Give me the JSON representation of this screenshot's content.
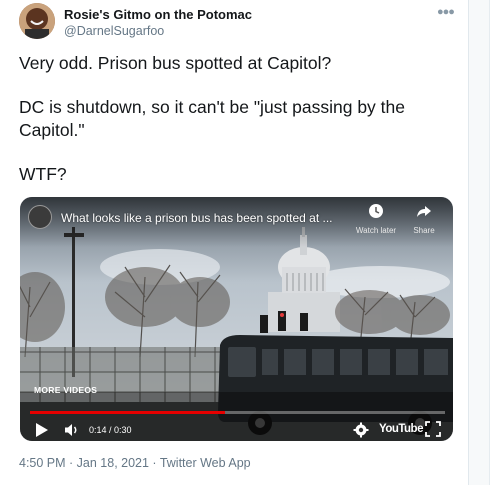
{
  "tweet": {
    "display_name": "Rosie's Gitmo on the Potomac",
    "handle": "@DarnelSugarfoo",
    "more_icon": "ellipsis-icon",
    "paragraphs": [
      "Very odd. Prison bus spotted at Capitol?",
      "DC is shutdown, so it can't be \"just passing by the Capitol.\"",
      "WTF?"
    ],
    "meta": "4:50 PM · Jan 18, 2021 · Twitter Web App"
  },
  "video": {
    "title": "What looks like a prison bus has been spotted at ...",
    "watch_later_label": "Watch later",
    "share_label": "Share",
    "more_videos_label": "MORE VIDEOS",
    "time_display": "0:14 / 0:30",
    "progress": 0.47,
    "brand": "YouTube",
    "colors": {
      "progress": "#e60000",
      "bus": "#1f2326"
    }
  }
}
